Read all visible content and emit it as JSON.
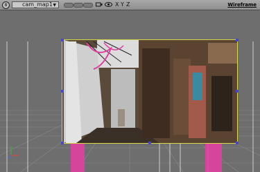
{
  "toolbar": {
    "menu_glyph": "8",
    "camera_name": "cam_map1",
    "dropdown_glyph": "▼",
    "axes": [
      "X",
      "Y",
      "Z"
    ],
    "mode": "Wireframe"
  },
  "viewport": {
    "background_color": "#6e6e6e",
    "grid_color": "#8a8a8a",
    "pink_color": "#e040a0",
    "frame_color": "#d7d74a",
    "handle_color": "#4a46c8"
  }
}
